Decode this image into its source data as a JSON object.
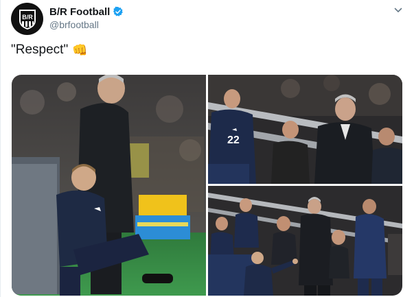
{
  "author": {
    "display_name": "B/R Football",
    "handle": "@brfootball",
    "avatar_text": "B/R"
  },
  "tweet": {
    "text": "\"Respect\"",
    "emoji": "👊",
    "emoji_name": "oncoming-fist"
  },
  "icons": {
    "verified": "verified-badge-icon",
    "menu": "chevron-down-icon"
  },
  "media": {
    "photos": [
      "photo-manager-with-ball-boy",
      "photo-manager-walking-by-bench",
      "photo-manager-fist-bump-ball-boy"
    ],
    "shirt_number": "22"
  },
  "colors": {
    "verified": "#1da1f2",
    "text_secondary": "#657786",
    "brand": "#111111"
  }
}
